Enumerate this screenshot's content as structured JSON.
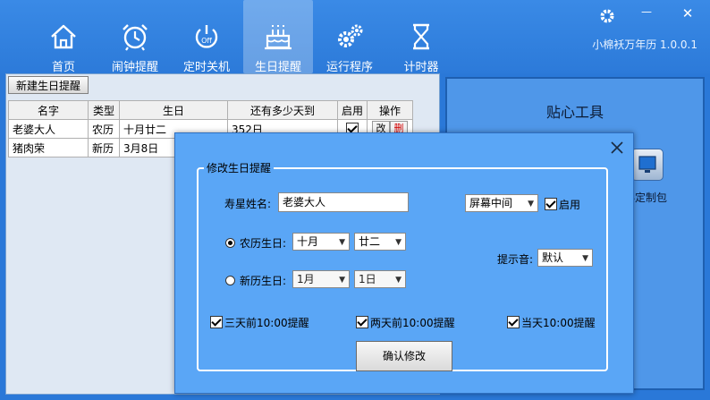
{
  "app": {
    "title": "小棉袄万年历 1.0.0.1",
    "accent_color": "#2c7ad9",
    "dialog_color": "#5aa6f6"
  },
  "window_controls": {
    "settings_icon": "gear-icon",
    "minimize": "—",
    "close": "✕"
  },
  "nav": {
    "items": [
      {
        "label": "首页",
        "icon": "home-icon"
      },
      {
        "label": "闹钟提醒",
        "icon": "alarm-clock-icon"
      },
      {
        "label": "定时关机",
        "icon": "power-off-icon"
      },
      {
        "label": "生日提醒",
        "icon": "birthday-cake-icon",
        "active": true
      },
      {
        "label": "运行程序",
        "icon": "gears-icon"
      },
      {
        "label": "计时器",
        "icon": "hourglass-icon"
      }
    ]
  },
  "list": {
    "new_button": "新建生日提醒",
    "columns": [
      "名字",
      "类型",
      "生日",
      "还有多少天到",
      "启用",
      "操作"
    ],
    "rows": [
      {
        "name": "老婆大人",
        "type": "农历",
        "birthday": "十月廿二",
        "days": "352日",
        "enabled": true,
        "edit": "改",
        "delete": "删"
      },
      {
        "name": "猪肉荣",
        "type": "新历",
        "birthday": "3月8日",
        "days": "",
        "enabled": false,
        "edit": "",
        "delete": ""
      }
    ]
  },
  "tools": {
    "title": "贴心工具",
    "item_label": "办定制包"
  },
  "dialog": {
    "group_title": "修改生日提醒",
    "name_label": "寿星姓名:",
    "name_value": "老婆大人",
    "position_value": "屏幕中间",
    "enable_label": "启用",
    "lunar_label": "农历生日:",
    "lunar_month": "十月",
    "lunar_day": "廿二",
    "solar_label": "新历生日:",
    "solar_month": "1月",
    "solar_day": "1日",
    "sound_label": "提示音:",
    "sound_value": "默认",
    "remind_3days": "三天前10:00提醒",
    "remind_2days": "两天前10:00提醒",
    "remind_today": "当天10:00提醒",
    "confirm_button": "确认修改"
  }
}
